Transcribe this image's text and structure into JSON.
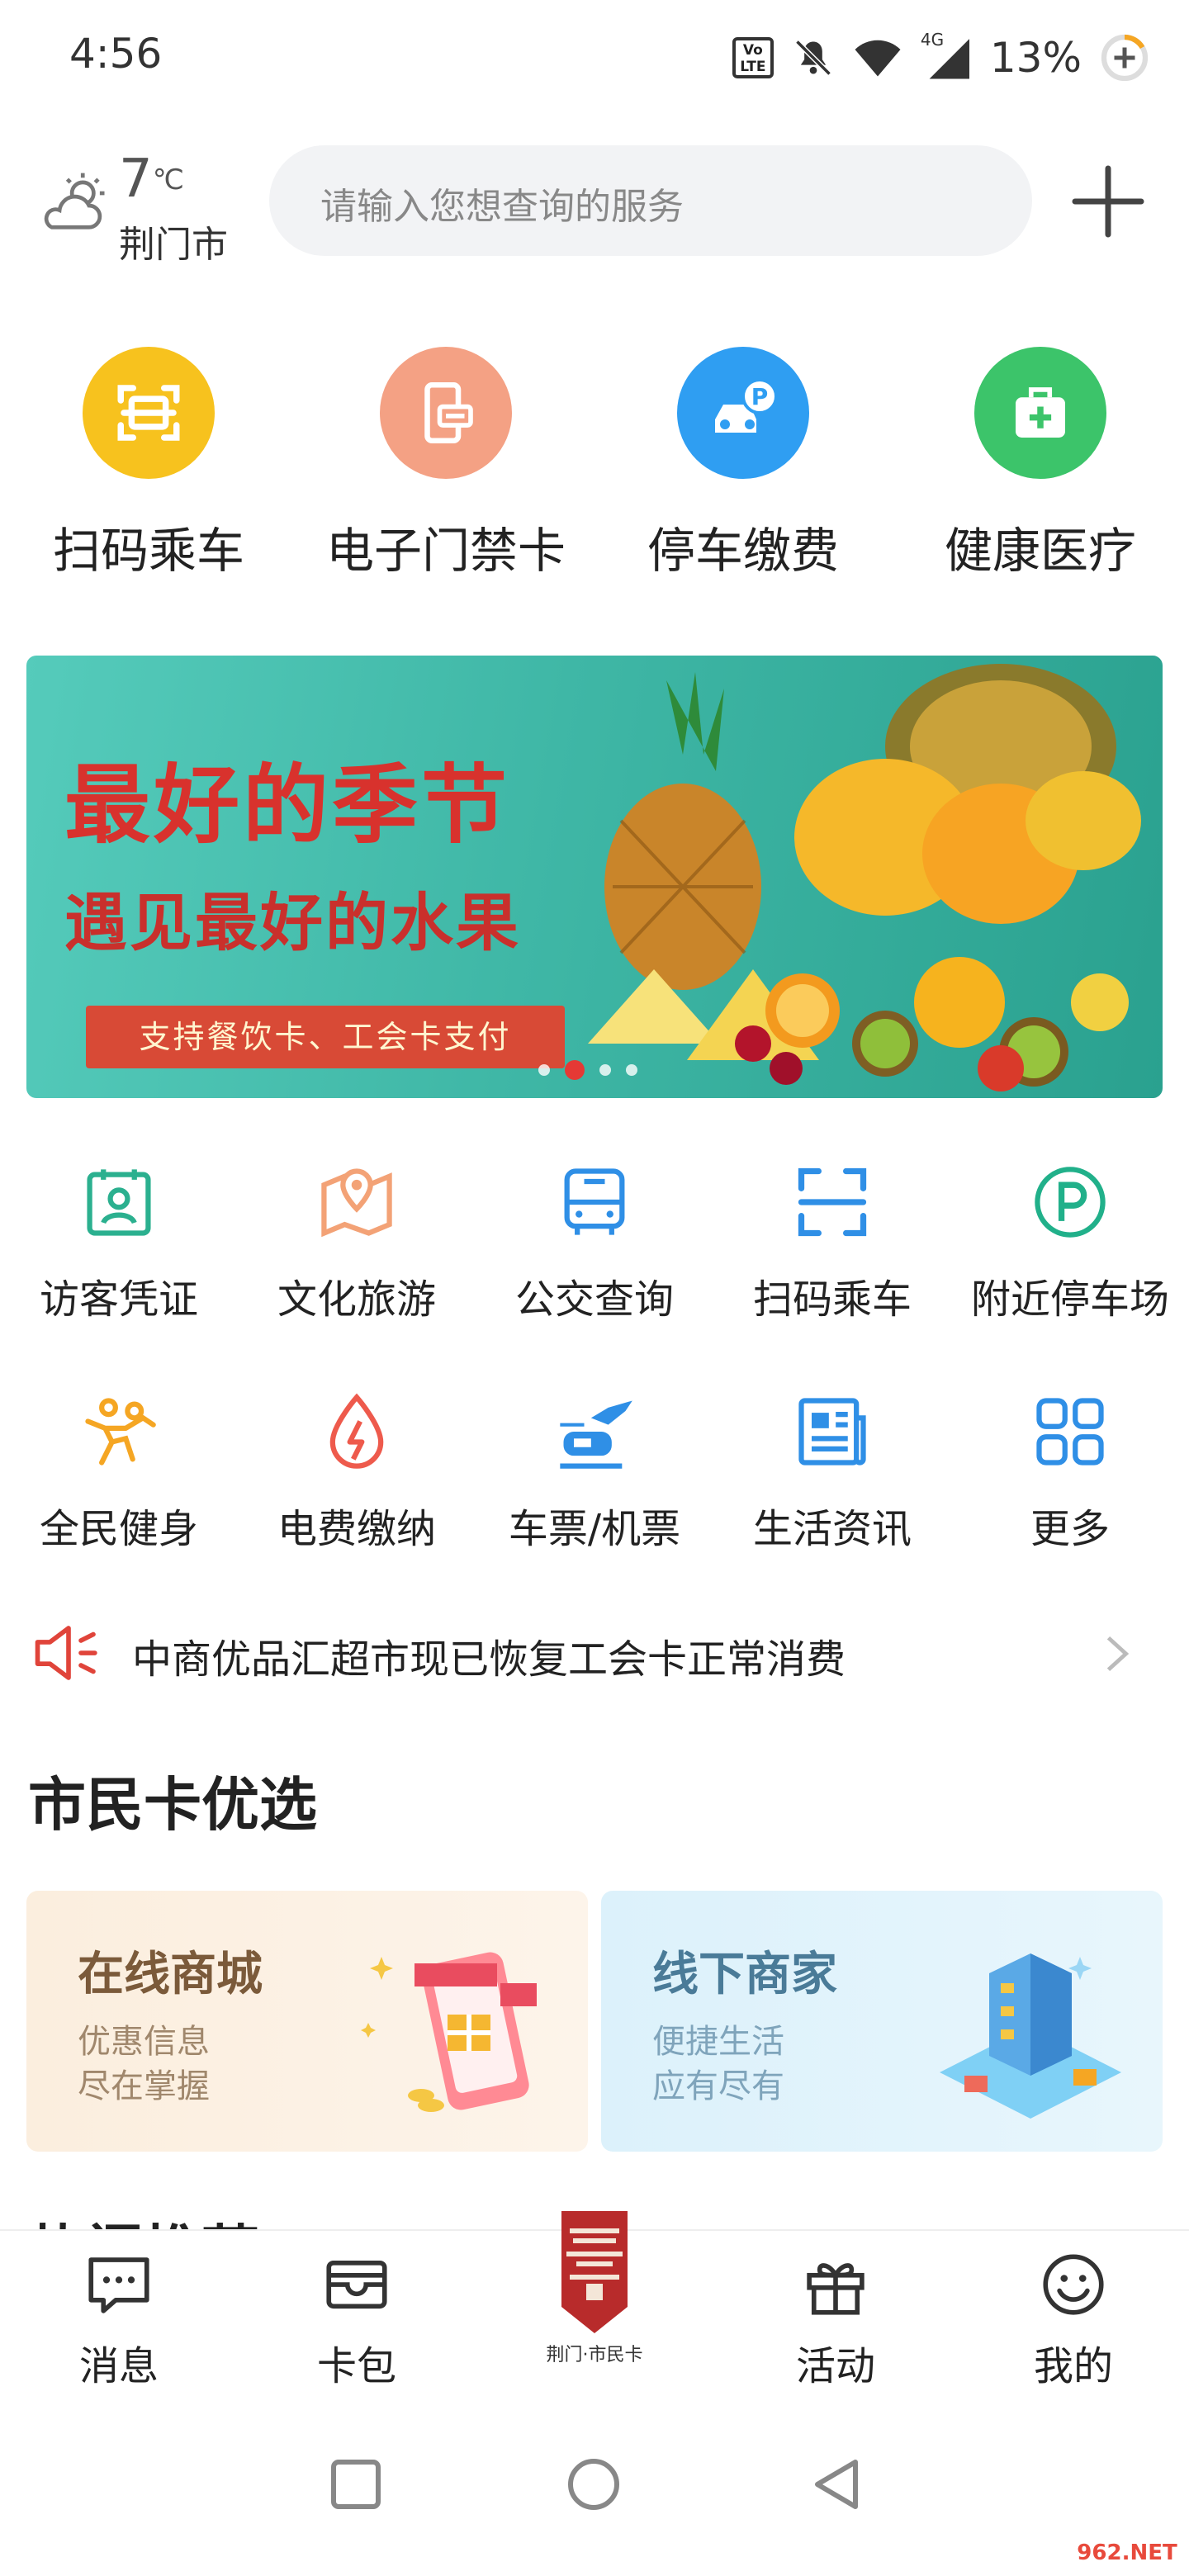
{
  "status_bar": {
    "time": "4:56",
    "network": "4G",
    "volte": "Vo LTE",
    "battery": "13%"
  },
  "header": {
    "weather": {
      "temp": "7",
      "unit": "℃",
      "city": "荆门市"
    },
    "search_placeholder": "请输入您想查询的服务"
  },
  "top_services": [
    {
      "label": "扫码乘车",
      "icon": "scan-icon",
      "color": "#f7c21e"
    },
    {
      "label": "电子门禁卡",
      "icon": "access-card-icon",
      "color": "#f4a184"
    },
    {
      "label": "停车缴费",
      "icon": "parking-car-icon",
      "color": "#2f9ef2"
    },
    {
      "label": "健康医疗",
      "icon": "medical-kit-icon",
      "color": "#3cc46a"
    }
  ],
  "banner": {
    "headline": "最好的季节",
    "subheadline": "遇见最好的水果",
    "pill": "支持餐饮卡、工会卡支付",
    "active_index": 1
  },
  "grid_row1": [
    {
      "label": "访客凭证",
      "icon": "visitor-icon"
    },
    {
      "label": "文化旅游",
      "icon": "map-pin-icon"
    },
    {
      "label": "公交查询",
      "icon": "bus-icon"
    },
    {
      "label": "扫码乘车",
      "icon": "scan-icon"
    },
    {
      "label": "附近停车场",
      "icon": "parking-icon"
    }
  ],
  "grid_row2": [
    {
      "label": "全民健身",
      "icon": "fitness-icon"
    },
    {
      "label": "电费缴纳",
      "icon": "electricity-icon"
    },
    {
      "label": "车票/机票",
      "icon": "train-plane-icon"
    },
    {
      "label": "生活资讯",
      "icon": "news-icon"
    },
    {
      "label": "更多",
      "icon": "more-grid-icon"
    }
  ],
  "notice": {
    "text": "中商优品汇超市现已恢复工会卡正常消费"
  },
  "section": {
    "title": "市民卡优选",
    "cards": [
      {
        "title": "在线商城",
        "line1": "优惠信息",
        "line2": "尽在掌握"
      },
      {
        "title": "线下商家",
        "line1": "便捷生活",
        "line2": "应有尽有"
      }
    ],
    "next_title": "热门推荐"
  },
  "bottom_nav": [
    {
      "label": "消息",
      "icon": "message-icon"
    },
    {
      "label": "卡包",
      "icon": "card-wallet-icon"
    },
    {
      "label": "荆门·市民卡",
      "icon": "city-card-logo"
    },
    {
      "label": "活动",
      "icon": "gift-icon"
    },
    {
      "label": "我的",
      "icon": "smile-icon"
    }
  ],
  "watermark": "962.NET"
}
